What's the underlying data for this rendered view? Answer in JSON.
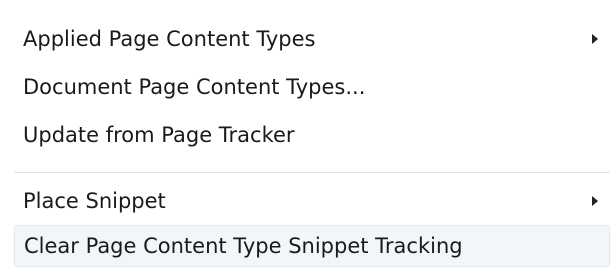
{
  "context_menu": {
    "items": [
      {
        "label": "Applied Page Content Types",
        "has_submenu": true
      },
      {
        "label": "Document Page Content Types...",
        "has_submenu": false
      },
      {
        "label": "Update from Page Tracker",
        "has_submenu": false
      },
      {
        "label": "Place Snippet",
        "has_submenu": true
      },
      {
        "label": "Clear Page Content Type Snippet Tracking",
        "has_submenu": false,
        "highlighted": true
      }
    ]
  },
  "icons": {
    "submenu_arrow": "submenu-arrow-icon"
  },
  "colors": {
    "menu_background": "#ffffff",
    "text": "#1a1a1a",
    "hover_background": "#f2f6fb",
    "hover_border": "#e1e9f3",
    "separator": "#e3e3e3"
  }
}
